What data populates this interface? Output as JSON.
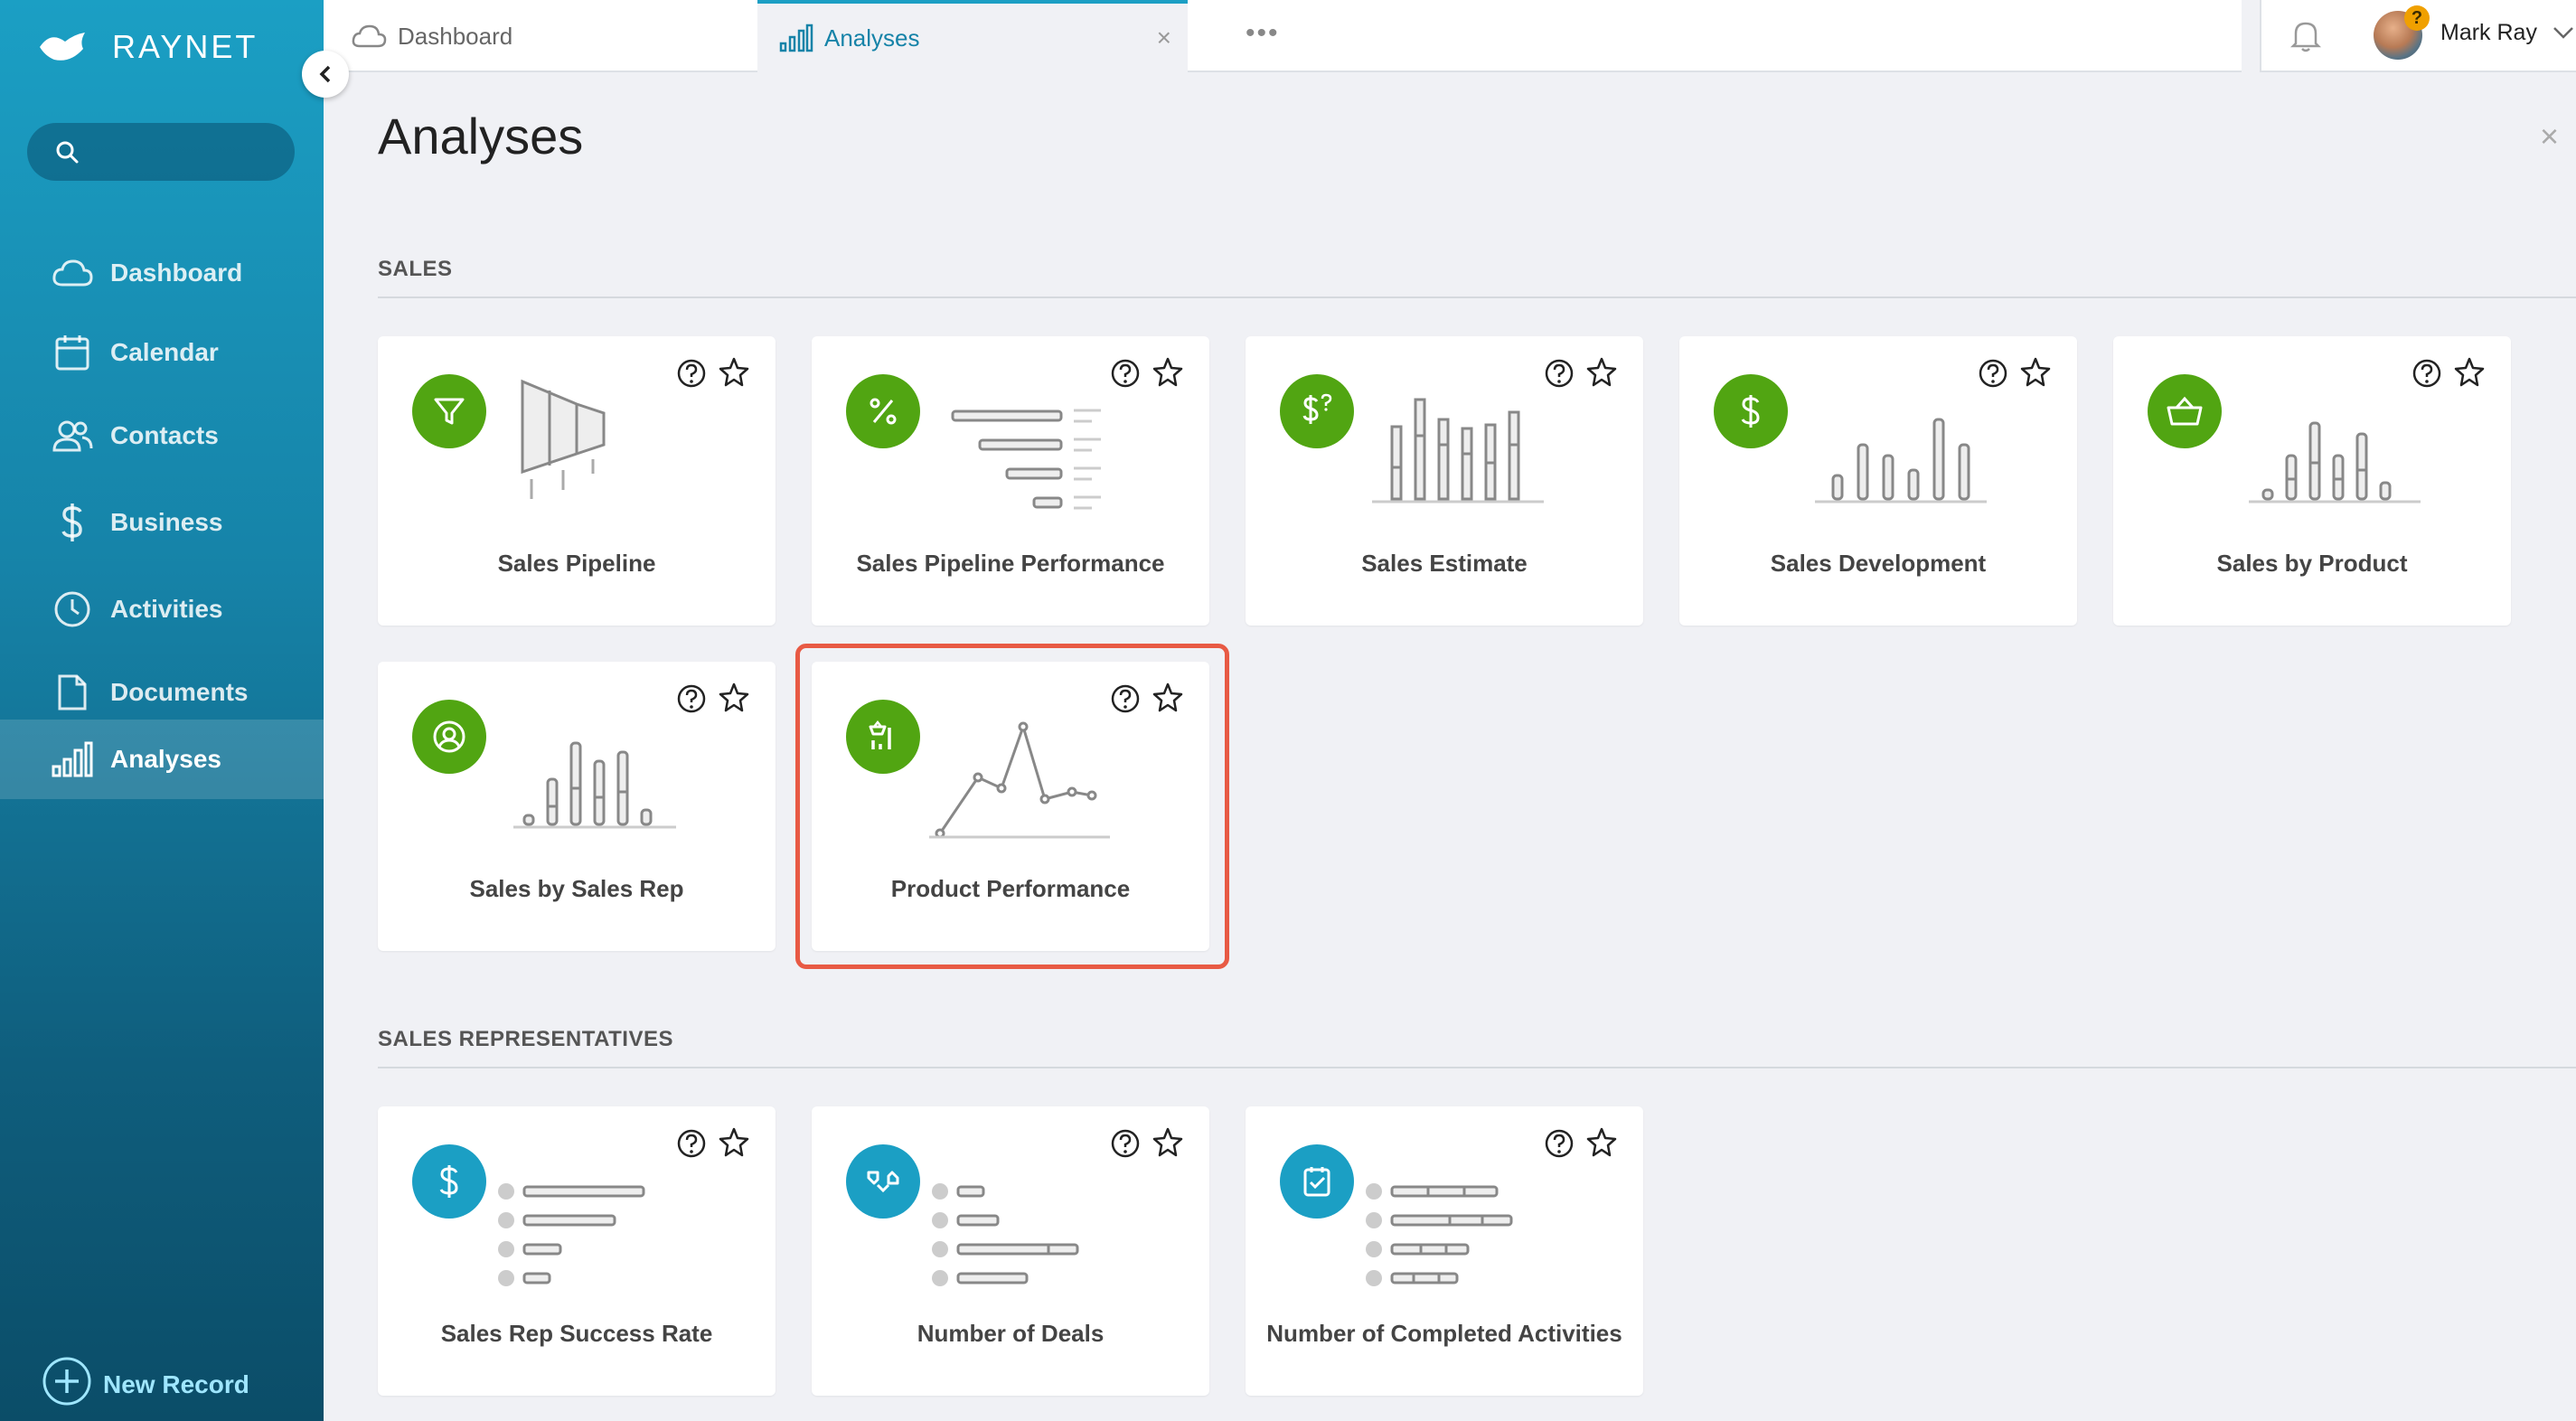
{
  "app": {
    "logo_text": "RAYNET"
  },
  "sidebar": {
    "items": [
      {
        "label": "Dashboard",
        "icon": "cloud-icon"
      },
      {
        "label": "Calendar",
        "icon": "calendar-icon"
      },
      {
        "label": "Contacts",
        "icon": "contacts-icon"
      },
      {
        "label": "Business",
        "icon": "dollar-icon"
      },
      {
        "label": "Activities",
        "icon": "clock-icon"
      },
      {
        "label": "Documents",
        "icon": "document-icon"
      },
      {
        "label": "Analyses",
        "icon": "bar-chart-icon",
        "active": true
      }
    ],
    "new_record": "New Record"
  },
  "tabs": [
    {
      "label": "Dashboard",
      "icon": "cloud-icon"
    },
    {
      "label": "Analyses",
      "icon": "bar-chart-icon",
      "active": true
    }
  ],
  "tab_more": "•••",
  "user": {
    "name": "Mark Ray",
    "badge": "?"
  },
  "page": {
    "title": "Analyses",
    "close": "×"
  },
  "sections": [
    {
      "title": "SALES",
      "cards": [
        {
          "label": "Sales Pipeline",
          "icon": "funnel-icon"
        },
        {
          "label": "Sales Pipeline Performance",
          "icon": "percent-icon"
        },
        {
          "label": "Sales Estimate",
          "icon": "dollar-question-icon"
        },
        {
          "label": "Sales Development",
          "icon": "dollar-icon"
        },
        {
          "label": "Sales by Product",
          "icon": "basket-icon"
        },
        {
          "label": "Sales by Sales Rep",
          "icon": "user-circle-icon"
        },
        {
          "label": "Product Performance",
          "icon": "product-chart-icon",
          "highlighted": true
        }
      ]
    },
    {
      "title": "SALES REPRESENTATIVES",
      "cards": [
        {
          "label": "Sales Rep Success Rate",
          "icon": "dollar-icon"
        },
        {
          "label": "Number of Deals",
          "icon": "handshake-icon"
        },
        {
          "label": "Number of Completed Activities",
          "icon": "checklist-icon"
        }
      ]
    }
  ],
  "colors": {
    "sidebar": "#1683a8",
    "accent": "#1b9fc4",
    "green": "#51a512",
    "highlight": "#e85a44"
  }
}
